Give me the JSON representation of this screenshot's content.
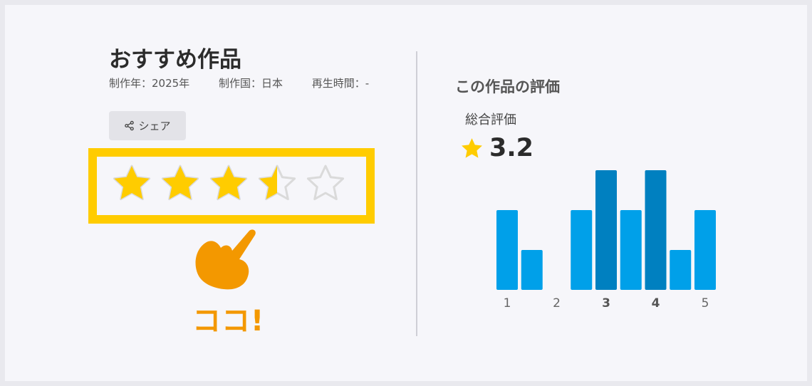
{
  "work": {
    "title": "おすすめ作品",
    "year": "制作年：2025年",
    "country": "制作国：日本",
    "duration": "再生時間：-",
    "share_label": "シェア"
  },
  "user_rating": {
    "value": 3.5,
    "max": 5,
    "filled_color": "#ffcc00",
    "empty_color": "#dadada",
    "highlight_color": "#ffcc00"
  },
  "annotation": {
    "text": "ココ!",
    "color": "#f39800",
    "icon": "pointing-hand-icon"
  },
  "evaluation": {
    "heading": "この作品の評価",
    "overall_label": "総合評価",
    "score": "3.2",
    "star_color": "#ffcc00"
  },
  "chart_data": {
    "type": "bar",
    "x": [
      1,
      1.5,
      2,
      2.5,
      3,
      3.5,
      4,
      4.5,
      5
    ],
    "values": [
      2,
      1,
      0,
      2,
      3,
      2,
      3,
      1,
      2
    ],
    "highlighted_categories": [
      3,
      4
    ],
    "tick_labels": [
      "1",
      "2",
      "3",
      "4",
      "5"
    ],
    "bold_ticks": [
      "3",
      "4"
    ],
    "color": "#00a0e9",
    "highlight_color": "#0080c0",
    "ylim": [
      0,
      3
    ]
  }
}
